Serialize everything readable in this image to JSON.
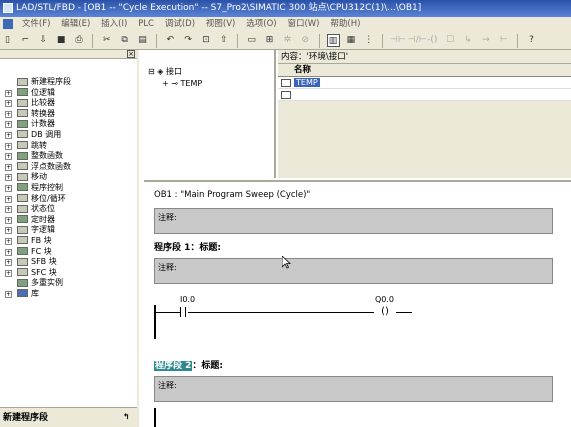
{
  "titlebar": {
    "title": "LAD/STL/FBD - [OB1 -- \"Cycle Execution\" -- S7_Pro2\\SIMATIC 300 站点\\CPU312C(1)\\...\\OB1]"
  },
  "menubar": {
    "items": [
      "文件(F)",
      "编辑(E)",
      "插入(I)",
      "PLC",
      "调试(D)",
      "视图(V)",
      "选项(O)",
      "窗口(W)",
      "帮助(H)"
    ]
  },
  "left_panel": {
    "tree_items": [
      {
        "label": "新建程序段",
        "expander": "",
        "icon": "network-icon"
      },
      {
        "label": "位逻辑",
        "expander": "+",
        "icon": "bit-logic-icon"
      },
      {
        "label": "比较器",
        "expander": "+",
        "icon": "comparator-icon"
      },
      {
        "label": "转换器",
        "expander": "+",
        "icon": "converter-icon"
      },
      {
        "label": "计数器",
        "expander": "+",
        "icon": "counter-icon"
      },
      {
        "label": "DB 调用",
        "expander": "+",
        "icon": "db-call-icon"
      },
      {
        "label": "跳转",
        "expander": "+",
        "icon": "jump-icon"
      },
      {
        "label": "整数函数",
        "expander": "+",
        "icon": "integer-function-icon"
      },
      {
        "label": "浮点数函数",
        "expander": "+",
        "icon": "float-function-icon"
      },
      {
        "label": "移动",
        "expander": "+",
        "icon": "move-icon"
      },
      {
        "label": "程序控制",
        "expander": "+",
        "icon": "program-control-icon"
      },
      {
        "label": "移位/循环",
        "expander": "+",
        "icon": "shift-rotate-icon"
      },
      {
        "label": "状态位",
        "expander": "+",
        "icon": "status-bit-icon"
      },
      {
        "label": "定时器",
        "expander": "+",
        "icon": "timer-icon"
      },
      {
        "label": "字逻辑",
        "expander": "+",
        "icon": "word-logic-icon"
      },
      {
        "label": "FB 块",
        "expander": "+",
        "icon": "fb-block-icon"
      },
      {
        "label": "FC 块",
        "expander": "+",
        "icon": "fc-block-icon"
      },
      {
        "label": "SFB 块",
        "expander": "+",
        "icon": "sfb-block-icon"
      },
      {
        "label": "SFC 块",
        "expander": "+",
        "icon": "sfc-block-icon"
      },
      {
        "label": "多重实例",
        "expander": "",
        "icon": "multi-instance-icon"
      },
      {
        "label": "库",
        "expander": "+",
        "icon": "library-icon"
      }
    ],
    "bottom_label": "新建程序段"
  },
  "variables": {
    "tree_root": "接口",
    "tree_child": "TEMP",
    "content_label": "内容：'环境\\接口'",
    "column_header": "名称",
    "rows": [
      "TEMP",
      ""
    ]
  },
  "editor": {
    "block_header": "OB1 :   \"Main Program Sweep (Cycle)\"",
    "block_comment": "注释:",
    "network1_title": "程序段 1：标题:",
    "network1_comment": "注释:",
    "contact_address": "I0.0",
    "coil_address": "Q0.0",
    "coil_symbol": "()",
    "network2_highlight": "程序段 2",
    "network2_title_rest": "：标题:",
    "network2_comment": "注释:"
  }
}
